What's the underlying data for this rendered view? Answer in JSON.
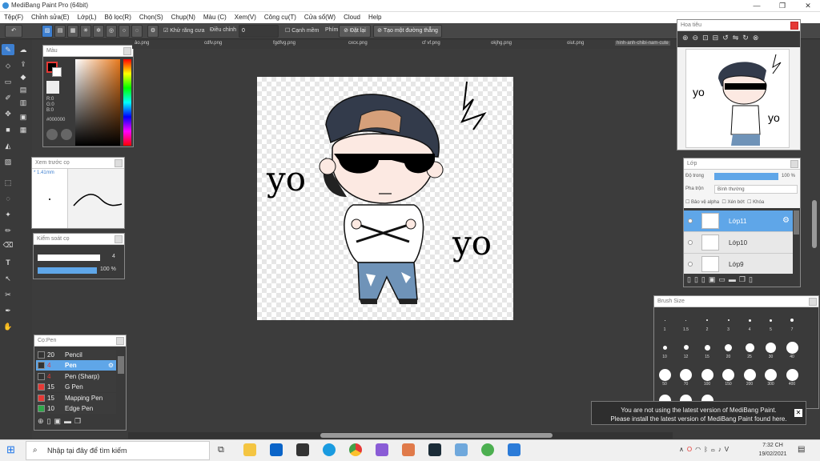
{
  "window": {
    "title": "MediBang Paint Pro (64bit)"
  },
  "menu": [
    "Tệp(F)",
    "Chỉnh sửa(E)",
    "Lớp(L)",
    "Bộ lọc(R)",
    "Chọn(S)",
    "Chụp(N)",
    "Màu (C)",
    "Xem(V)",
    "Công cụ(T)",
    "Cửa sổ(W)",
    "Cloud",
    "Help"
  ],
  "toolbar": {
    "antialias": "Khử răng cưa",
    "adjust": "Điều chỉnh",
    "adjust_value": "0",
    "edge": "Cạnh mềm",
    "key": "Phím",
    "set": "Đặt lại",
    "straight": "Tạo một đường thẳng"
  },
  "tabs": [
    "ảo.png",
    "cdfv.png",
    "fgdfvg.png",
    "cxcx.png",
    "cf vf.png",
    "okjhg.png",
    "oiut.png",
    "hinh-anh-chibi-nam-cute"
  ],
  "color_panel": {
    "title": "Màu",
    "r": "R:0",
    "g": "G:0",
    "b": "B:0",
    "hex": "#000000"
  },
  "brush_preview": {
    "title": "Xem trước cọ",
    "size": "1.41mm"
  },
  "brush_control": {
    "title": "Kiểm soát cọ",
    "size_value": "4",
    "opacity": "100 %"
  },
  "brush_list": {
    "title": "Cọ:Pen",
    "items": [
      {
        "size": "20",
        "name": "Pencil",
        "color": "#333333"
      },
      {
        "size": "4",
        "name": "Pen",
        "color": "#333333"
      },
      {
        "size": "4",
        "name": "Pen (Sharp)",
        "color": "#333333"
      },
      {
        "size": "15",
        "name": "G Pen",
        "color": "#e53935"
      },
      {
        "size": "15",
        "name": "Mapping Pen",
        "color": "#e53935"
      },
      {
        "size": "10",
        "name": "Edge Pen",
        "color": "#2ea84a"
      }
    ]
  },
  "navigator": {
    "title": "Hoa tiêu"
  },
  "layers": {
    "title": "Lớp",
    "opacity_label": "Độ trong",
    "opacity_value": "100 %",
    "blend_label": "Pha trộn",
    "blend_value": "Bình thường",
    "protect_alpha": "Bảo vệ alpha",
    "clip": "Xén bớt",
    "lock": "Khóa",
    "items": [
      {
        "name": "Lớp11",
        "selected": true
      },
      {
        "name": "Lớp10",
        "selected": false
      },
      {
        "name": "Lớp9",
        "selected": false
      }
    ]
  },
  "brush_size": {
    "title": "Brush Size",
    "labels_row1": [
      "1",
      "1.5",
      "2",
      "3",
      "4",
      "5",
      "7"
    ],
    "labels_row2": [
      "10",
      "12",
      "15",
      "20",
      "25",
      "30",
      "40"
    ],
    "labels_row3": [
      "50",
      "70",
      "100",
      "150",
      "200",
      "300",
      "400"
    ]
  },
  "notification": {
    "line1": "You are not using the latest version of MediBang Paint.",
    "line2": "Please install the latest version of MediBang Paint found here."
  },
  "taskbar": {
    "search_placeholder": "Nhập tại đây để tìm kiếm",
    "time": "7:32 CH",
    "date": "19/02/2021"
  },
  "artwork": {
    "text_left": "yo",
    "text_right": "yo"
  }
}
